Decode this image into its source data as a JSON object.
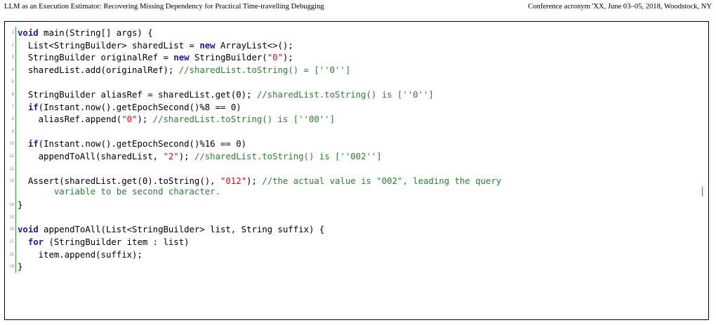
{
  "header": {
    "left": "LLM as an Execution Estimator: Recovering Missing Dependency for Practical Time-travelling Debugging",
    "right": "Conference acronym 'XX, June 03–05, 2018, Woodstock, NY"
  },
  "listing": {
    "lines": [
      {
        "n": "1",
        "tokens": [
          {
            "t": "k",
            "v": "void"
          },
          {
            "t": "p",
            "v": " main(String[] args) {"
          }
        ]
      },
      {
        "n": "2",
        "tokens": [
          {
            "t": "p",
            "v": "  List<StringBuilder> sharedList = "
          },
          {
            "t": "k",
            "v": "new"
          },
          {
            "t": "p",
            "v": " ArrayList<>();"
          }
        ]
      },
      {
        "n": "3",
        "tokens": [
          {
            "t": "p",
            "v": "  StringBuilder originalRef = "
          },
          {
            "t": "k",
            "v": "new"
          },
          {
            "t": "p",
            "v": " StringBuilder("
          },
          {
            "t": "s",
            "v": "\"0\""
          },
          {
            "t": "p",
            "v": ");"
          }
        ]
      },
      {
        "n": "4",
        "tokens": [
          {
            "t": "p",
            "v": "  sharedList.add(originalRef); "
          },
          {
            "t": "c",
            "v": "//sharedList.toString() = [''0'']"
          }
        ]
      },
      {
        "n": "5",
        "tokens": []
      },
      {
        "n": "6",
        "tokens": [
          {
            "t": "p",
            "v": "  StringBuilder aliasRef = sharedList.get(0); "
          },
          {
            "t": "c",
            "v": "//sharedList.toString() is [''0'']"
          }
        ]
      },
      {
        "n": "7",
        "tokens": [
          {
            "t": "p",
            "v": "  "
          },
          {
            "t": "k",
            "v": "if"
          },
          {
            "t": "p",
            "v": "(Instant.now().getEpochSecond()%8 == 0)"
          }
        ]
      },
      {
        "n": "8",
        "tokens": [
          {
            "t": "p",
            "v": "    aliasRef.append("
          },
          {
            "t": "s",
            "v": "\"0\""
          },
          {
            "t": "p",
            "v": "); "
          },
          {
            "t": "c",
            "v": "//sharedList.toString() is [''00'']"
          }
        ]
      },
      {
        "n": "9",
        "tokens": []
      },
      {
        "n": "10",
        "tokens": [
          {
            "t": "p",
            "v": "  "
          },
          {
            "t": "k",
            "v": "if"
          },
          {
            "t": "p",
            "v": "(Instant.now().getEpochSecond()%16 == 0)"
          }
        ]
      },
      {
        "n": "11",
        "tokens": [
          {
            "t": "p",
            "v": "    appendToAll(sharedList, "
          },
          {
            "t": "s",
            "v": "\"2\""
          },
          {
            "t": "p",
            "v": "); "
          },
          {
            "t": "c",
            "v": "//sharedList.toString() is [''002'']"
          }
        ]
      },
      {
        "n": "12",
        "tokens": []
      },
      {
        "n": "13",
        "wrap": true,
        "tokens": [
          {
            "t": "p",
            "v": "  Assert(sharedList.get(0).toString(), "
          },
          {
            "t": "s",
            "v": "\"012\""
          },
          {
            "t": "p",
            "v": "); "
          },
          {
            "t": "c",
            "v": "//the actual value is \"002\", leading the query\n       variable to be second character."
          }
        ]
      },
      {
        "n": "14",
        "tokens": [
          {
            "t": "p",
            "v": "}"
          }
        ]
      },
      {
        "n": "15",
        "tokens": []
      },
      {
        "n": "16",
        "tokens": [
          {
            "t": "k",
            "v": "void"
          },
          {
            "t": "p",
            "v": " appendToAll(List<StringBuilder> list, String suffix) {"
          }
        ]
      },
      {
        "n": "17",
        "tokens": [
          {
            "t": "p",
            "v": "  "
          },
          {
            "t": "k",
            "v": "for"
          },
          {
            "t": "p",
            "v": " (StringBuilder item : list)"
          }
        ]
      },
      {
        "n": "18",
        "tokens": [
          {
            "t": "p",
            "v": "    item.append(suffix);"
          }
        ]
      },
      {
        "n": "19",
        "tokens": [
          {
            "t": "p",
            "v": "}"
          }
        ]
      }
    ]
  }
}
